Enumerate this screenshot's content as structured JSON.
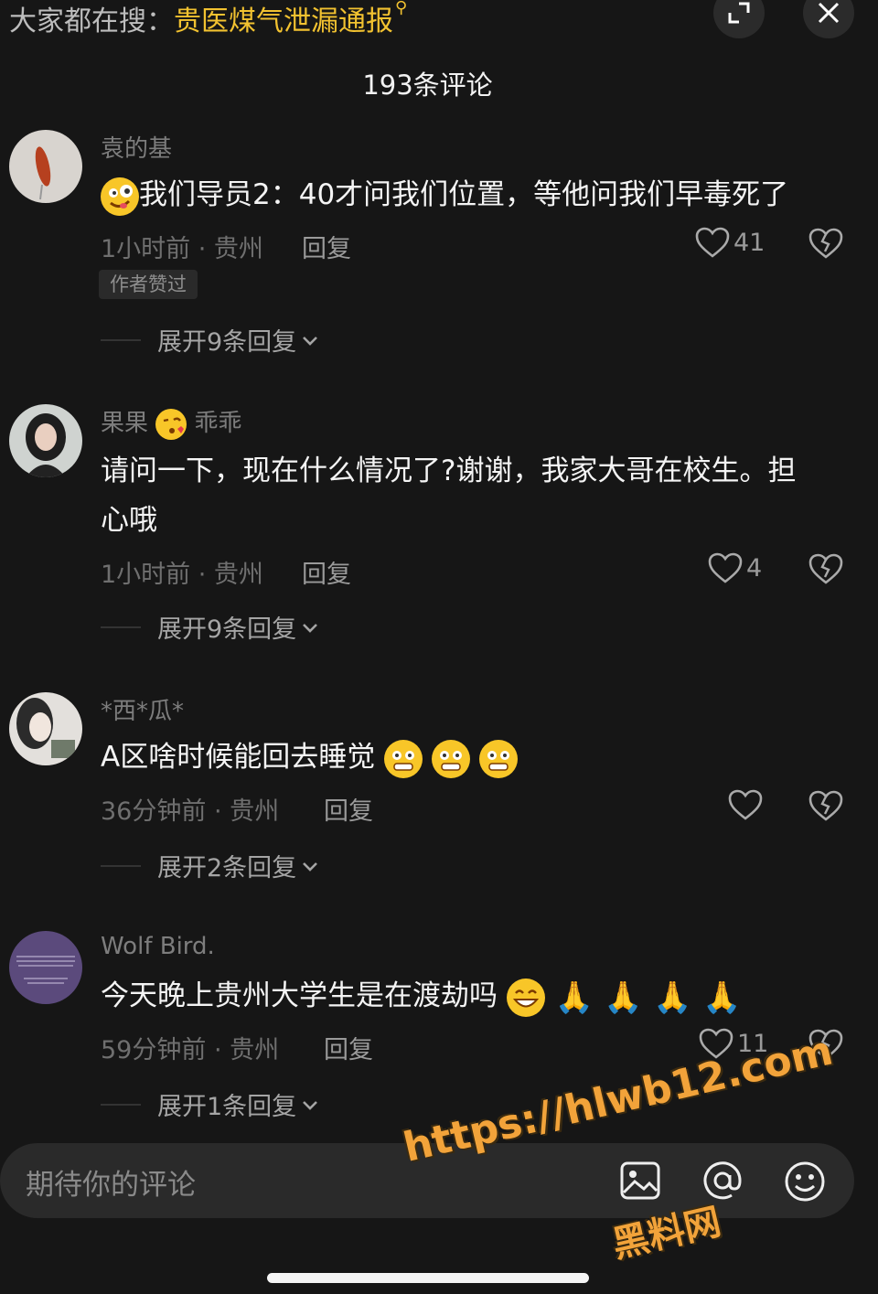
{
  "header": {
    "search_prefix": "大家都在搜：",
    "search_term": "贵医煤气泄漏通报",
    "search_icon": "search-icon",
    "expand_icon": "expand-icon",
    "close_icon": "close-icon"
  },
  "comments_title": "193条评论",
  "comments": [
    {
      "username": "袁的基",
      "text_after_emoji": "我们导员2：40才问我们位置，等他问我们早毒死了",
      "time_location": "1小时前 · 贵州",
      "reply_label": "回复",
      "likes": "41",
      "author_badge": "作者赞过",
      "expand_label": "展开9条回复"
    },
    {
      "username_a": "果果",
      "username_b": "乖乖",
      "text_line1": "请问一下，现在什么情况了?谢谢，我家大哥在校生。担",
      "text_line2": "心哦",
      "time_location": "1小时前 · 贵州",
      "reply_label": "回复",
      "likes": "4",
      "expand_label": "展开9条回复"
    },
    {
      "username": "*西*瓜*",
      "text": "A区啥时候能回去睡觉",
      "time_location": "36分钟前 · 贵州",
      "reply_label": "回复",
      "likes": "",
      "expand_label": "展开2条回复"
    },
    {
      "username": "Wolf Bird.",
      "text": "今天晚上贵州大学生是在渡劫吗",
      "time_location": "59分钟前 · 贵州",
      "reply_label": "回复",
      "likes": "11",
      "expand_label": "展开1条回复"
    }
  ],
  "input": {
    "placeholder": "期待你的评论",
    "icons": [
      "image-icon",
      "at-icon",
      "emoji-icon"
    ]
  },
  "watermark": {
    "url": "https://hlwb12.com",
    "name": "黑料网"
  },
  "colors": {
    "background": "#161616",
    "search_term": "#f2c230",
    "watermark": "#f2a33a"
  }
}
